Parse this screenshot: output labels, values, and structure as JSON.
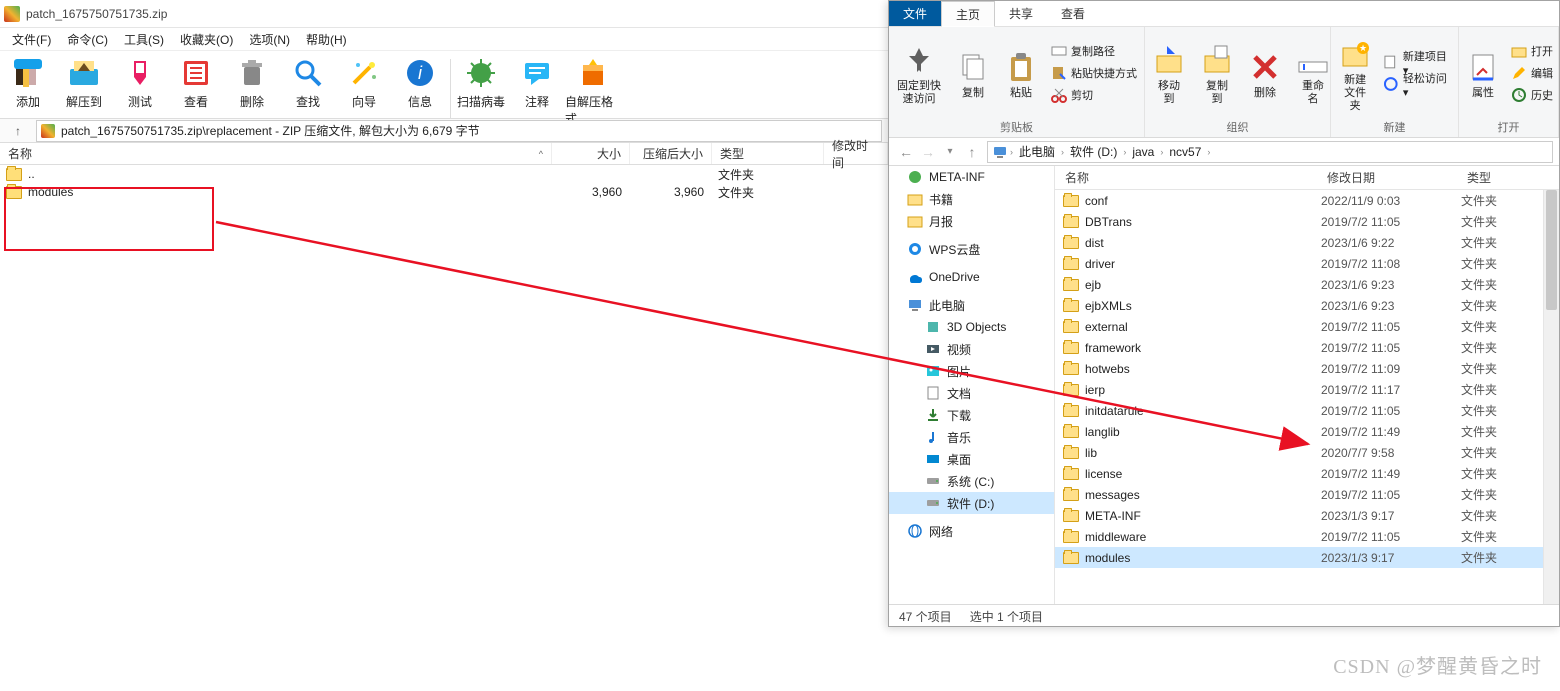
{
  "winrar": {
    "title": "patch_1675750751735.zip",
    "menu": [
      "文件(F)",
      "命令(C)",
      "工具(S)",
      "收藏夹(O)",
      "选项(N)",
      "帮助(H)"
    ],
    "toolbar": [
      {
        "id": "add",
        "label": "添加"
      },
      {
        "id": "extract",
        "label": "解压到"
      },
      {
        "id": "test",
        "label": "测试"
      },
      {
        "id": "view",
        "label": "查看"
      },
      {
        "id": "delete",
        "label": "删除"
      },
      {
        "id": "find",
        "label": "查找"
      },
      {
        "id": "wizard",
        "label": "向导"
      },
      {
        "id": "info",
        "label": "信息"
      },
      {
        "id": "sep"
      },
      {
        "id": "virus",
        "label": "扫描病毒"
      },
      {
        "id": "comment",
        "label": "注释"
      },
      {
        "id": "sfx",
        "label": "自解压格式"
      }
    ],
    "up_arrow": "↑",
    "path": "patch_1675750751735.zip\\replacement - ZIP 压缩文件, 解包大小为 6,679 字节",
    "cols": {
      "name": "名称",
      "size": "大小",
      "packed": "压缩后大小",
      "type": "类型",
      "modified": "修改时间"
    },
    "rows": [
      {
        "name": "..",
        "size": "",
        "packed": "",
        "type": "文件夹",
        "mod": "",
        "is_up": true
      },
      {
        "name": "modules",
        "size": "3,960",
        "packed": "3,960",
        "type": "文件夹",
        "mod": ""
      }
    ]
  },
  "explorer": {
    "tabs": {
      "file": "文件",
      "home": "主页",
      "share": "共享",
      "view": "查看"
    },
    "ribbon": {
      "clipboard": {
        "pin": "固定到快\n速访问",
        "copy": "复制",
        "paste": "粘贴",
        "copy_path": "复制路径",
        "paste_shortcut": "粘贴快捷方式",
        "cut": "剪切",
        "title": "剪贴板"
      },
      "organize": {
        "moveto": "移动到",
        "copyto": "复制到",
        "delete": "删除",
        "rename": "重命名",
        "title": "组织"
      },
      "new": {
        "newfolder": "新建\n文件夹",
        "newitem": "新建项目 ▾",
        "easyaccess": "轻松访问 ▾",
        "title": "新建"
      },
      "open": {
        "props": "属性",
        "title": "打开",
        "open_btn": "打开",
        "edit": "编辑",
        "history": "历史"
      }
    },
    "nav": {
      "back": "←",
      "fwd": "→",
      "recent": "▾",
      "up": "↑",
      "crumbs": [
        "此电脑",
        "软件 (D:)",
        "java",
        "ncv57"
      ]
    },
    "tree": [
      {
        "icon": "exe",
        "label": "META-INF"
      },
      {
        "icon": "folder",
        "label": "书籍"
      },
      {
        "icon": "folder",
        "label": "月报"
      },
      {
        "sep": true
      },
      {
        "icon": "wps",
        "label": "WPS云盘"
      },
      {
        "sep": true
      },
      {
        "icon": "onedrive",
        "label": "OneDrive"
      },
      {
        "sep": true
      },
      {
        "icon": "pc",
        "label": "此电脑"
      },
      {
        "icon": "3d",
        "label": "3D Objects",
        "indent": true
      },
      {
        "icon": "video",
        "label": "视频",
        "indent": true
      },
      {
        "icon": "pic",
        "label": "图片",
        "indent": true
      },
      {
        "icon": "doc",
        "label": "文档",
        "indent": true
      },
      {
        "icon": "dl",
        "label": "下载",
        "indent": true
      },
      {
        "icon": "music",
        "label": "音乐",
        "indent": true
      },
      {
        "icon": "desk",
        "label": "桌面",
        "indent": true
      },
      {
        "icon": "disk",
        "label": "系统 (C:)",
        "indent": true
      },
      {
        "icon": "disk",
        "label": "软件 (D:)",
        "indent": true,
        "selected": true
      },
      {
        "sep": true
      },
      {
        "icon": "net",
        "label": "网络"
      }
    ],
    "list_cols": {
      "name": "名称",
      "modified": "修改日期",
      "type": "类型"
    },
    "files": [
      {
        "name": "conf",
        "date": "2022/11/9 0:03",
        "type": "文件夹"
      },
      {
        "name": "DBTrans",
        "date": "2019/7/2 11:05",
        "type": "文件夹"
      },
      {
        "name": "dist",
        "date": "2023/1/6 9:22",
        "type": "文件夹"
      },
      {
        "name": "driver",
        "date": "2019/7/2 11:08",
        "type": "文件夹"
      },
      {
        "name": "ejb",
        "date": "2023/1/6 9:23",
        "type": "文件夹"
      },
      {
        "name": "ejbXMLs",
        "date": "2023/1/6 9:23",
        "type": "文件夹"
      },
      {
        "name": "external",
        "date": "2019/7/2 11:05",
        "type": "文件夹"
      },
      {
        "name": "framework",
        "date": "2019/7/2 11:05",
        "type": "文件夹"
      },
      {
        "name": "hotwebs",
        "date": "2019/7/2 11:09",
        "type": "文件夹"
      },
      {
        "name": "ierp",
        "date": "2019/7/2 11:17",
        "type": "文件夹"
      },
      {
        "name": "initdatarule",
        "date": "2019/7/2 11:05",
        "type": "文件夹"
      },
      {
        "name": "langlib",
        "date": "2019/7/2 11:49",
        "type": "文件夹"
      },
      {
        "name": "lib",
        "date": "2020/7/7 9:58",
        "type": "文件夹"
      },
      {
        "name": "license",
        "date": "2019/7/2 11:49",
        "type": "文件夹"
      },
      {
        "name": "messages",
        "date": "2019/7/2 11:05",
        "type": "文件夹"
      },
      {
        "name": "META-INF",
        "date": "2023/1/3 9:17",
        "type": "文件夹"
      },
      {
        "name": "middleware",
        "date": "2019/7/2 11:05",
        "type": "文件夹"
      },
      {
        "name": "modules",
        "date": "2023/1/3 9:17",
        "type": "文件夹",
        "selected": true
      }
    ],
    "status": {
      "count": "47 个项目",
      "selected": "选中 1 个项目"
    }
  },
  "watermark": "CSDN @梦醒黄昏之时"
}
